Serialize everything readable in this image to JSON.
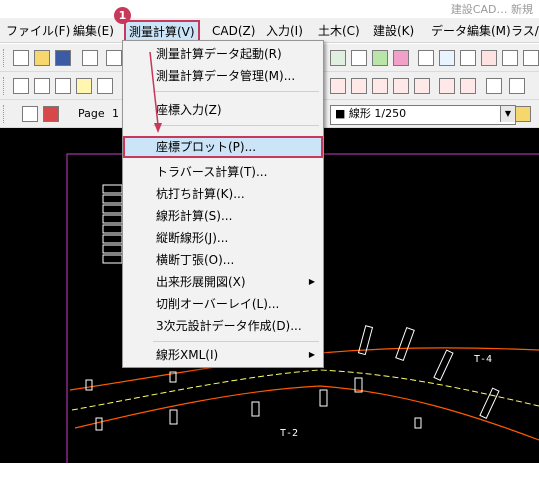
{
  "title_text": "建設CAD… 新規",
  "menubar": [
    {
      "label": "ファイル(F)"
    },
    {
      "label": "編集(E)"
    },
    {
      "label": "測量計算(V)"
    },
    {
      "label": "CAD(Z)"
    },
    {
      "label": "入力(I)"
    },
    {
      "label": "土木(C)"
    },
    {
      "label": "建設(K)"
    },
    {
      "label": "データ編集(M)"
    },
    {
      "label": "ラス/"
    }
  ],
  "toolbar": {
    "page_label": "Page",
    "page_value": "1",
    "layer_value": "■ 線形 1/250"
  },
  "step_badge": "1",
  "dropdown": {
    "items": [
      {
        "label": "測量計算データ起動(R)"
      },
      {
        "label": "測量計算データ管理(M)..."
      },
      {
        "label": "座標入力(Z)"
      },
      {
        "label": "座標プロット(P)..."
      },
      {
        "label": "トラバース計算(T)..."
      },
      {
        "label": "杭打ち計算(K)..."
      },
      {
        "label": "線形計算(S)..."
      },
      {
        "label": "縦断線形(J)..."
      },
      {
        "label": "横断丁張(O)..."
      },
      {
        "label": "出来形展開図(X)"
      },
      {
        "label": "切削オーバーレイ(L)..."
      },
      {
        "label": "3次元設計データ作成(D)..."
      },
      {
        "label": "線形XML(I)"
      }
    ]
  },
  "canvas": {
    "label_t4": "T-4",
    "label_t2": "T-2"
  },
  "colors": {
    "highlight_border": "#c8385a",
    "highlight_fill": "#cce4f7",
    "canvas_bg": "#000000",
    "frame_magenta": "#c83cc8",
    "road_line": "#ff5a00",
    "center_line": "#ffff60"
  }
}
